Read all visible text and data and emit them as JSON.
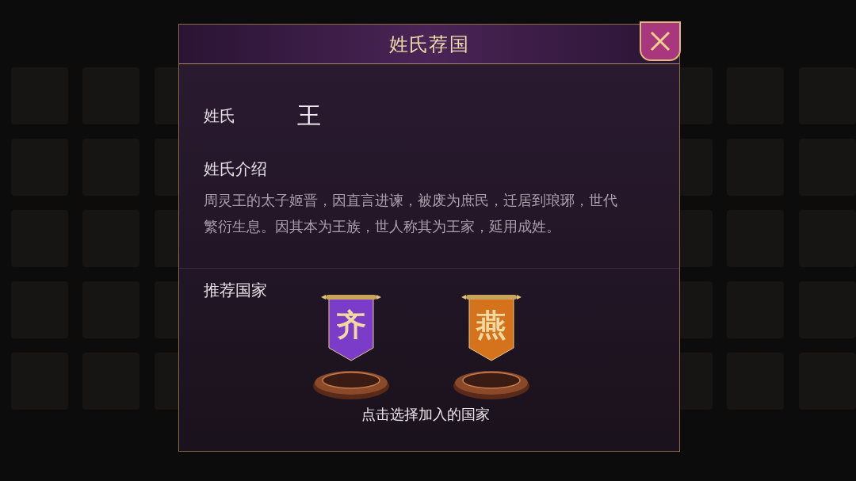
{
  "dialog": {
    "title": "姓氏荐国",
    "surname_label": "姓氏",
    "surname": "王",
    "intro_label": "姓氏介绍",
    "intro": "周灵王的太子姬晋，因直言进谏，被废为庶民，迁居到琅琊，世代繁衍生息。因其本为王族，世人称其为王家，延用成姓。",
    "recommend_label": "推荐国家",
    "countries": [
      {
        "name": "齐",
        "color": "#7b3dc9"
      },
      {
        "name": "燕",
        "color": "#d4731c"
      }
    ],
    "hint": "点击选择加入的国家"
  }
}
